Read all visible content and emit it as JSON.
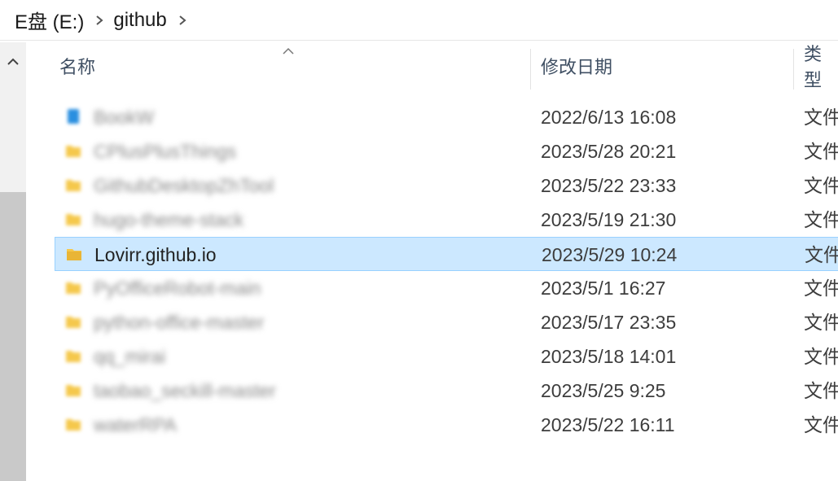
{
  "breadcrumb": {
    "items": [
      "E盘 (E:)",
      "github"
    ]
  },
  "list": {
    "columns": {
      "name": "名称",
      "date": "修改日期",
      "type": "类型"
    },
    "sorted_by": "name",
    "rows": [
      {
        "name": "BookW",
        "date": "2022/6/13 16:08",
        "type": "文件",
        "icon": "blue-folder-icon",
        "blurred": true
      },
      {
        "name": "CPlusPlusThings",
        "date": "2023/5/28 20:21",
        "type": "文件",
        "icon": "folder-icon",
        "blurred": true
      },
      {
        "name": "GithubDesktopZhTool",
        "date": "2023/5/22 23:33",
        "type": "文件",
        "icon": "folder-icon",
        "blurred": true
      },
      {
        "name": "hugo-theme-stack",
        "date": "2023/5/19 21:30",
        "type": "文件",
        "icon": "folder-icon",
        "blurred": true
      },
      {
        "name": "Lovirr.github.io",
        "date": "2023/5/29 10:24",
        "type": "文件",
        "icon": "folder-icon",
        "blurred": false,
        "selected": true
      },
      {
        "name": "PyOfficeRobot-main",
        "date": "2023/5/1 16:27",
        "type": "文件",
        "icon": "folder-icon",
        "blurred": true
      },
      {
        "name": "python-office-master",
        "date": "2023/5/17 23:35",
        "type": "文件",
        "icon": "folder-icon",
        "blurred": true
      },
      {
        "name": "qq_mirai",
        "date": "2023/5/18 14:01",
        "type": "文件",
        "icon": "folder-icon",
        "blurred": true
      },
      {
        "name": "taobao_seckill-master",
        "date": "2023/5/25 9:25",
        "type": "文件",
        "icon": "folder-icon",
        "blurred": true
      },
      {
        "name": "waterRPA",
        "date": "2023/5/22 16:11",
        "type": "文件",
        "icon": "folder-icon",
        "blurred": true
      }
    ]
  },
  "colors": {
    "selection_bg": "#cce8ff",
    "selection_border": "#99d1ff",
    "folder": "#f5c84c",
    "header_text": "#3f4f63"
  }
}
